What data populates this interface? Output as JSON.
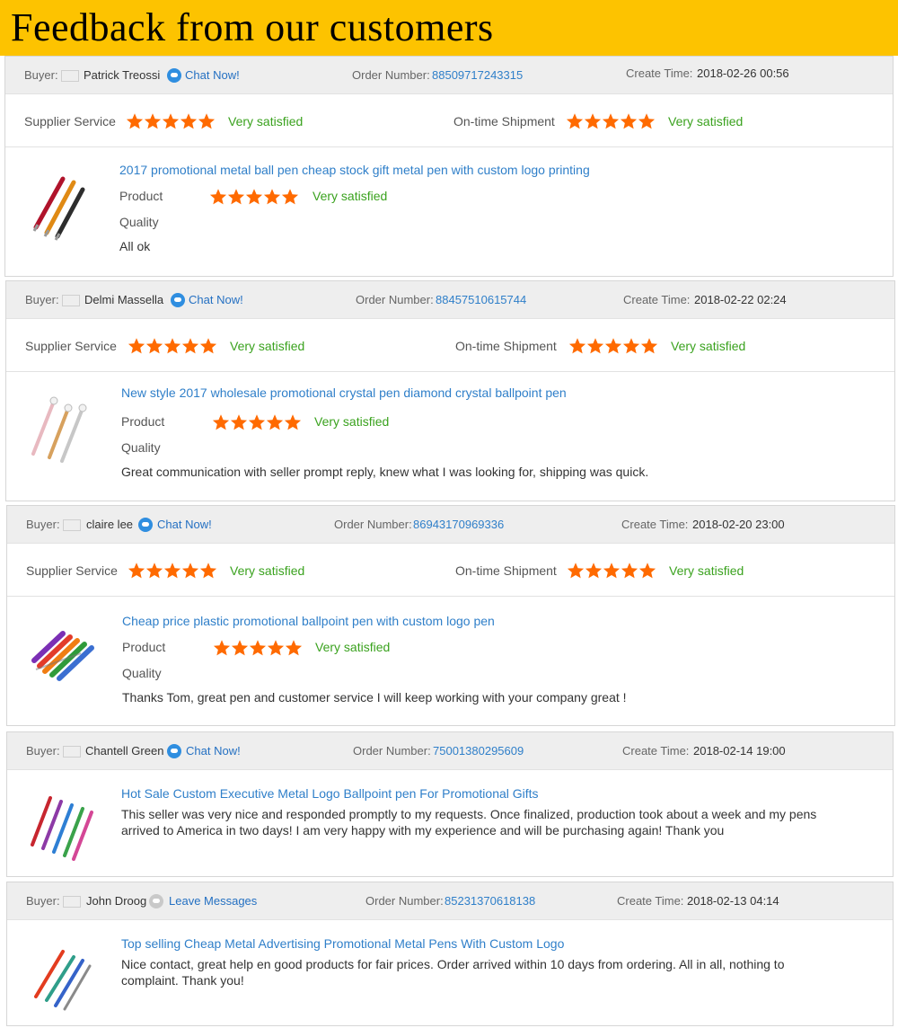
{
  "banner": {
    "title": "Feedback from our customers"
  },
  "labels": {
    "buyer": "Buyer:",
    "order_number": "Order Number:",
    "create_time": "Create Time:",
    "supplier_service": "Supplier Service",
    "ontime_shipment": "On-time Shipment",
    "product": "Product",
    "quality": "Quality"
  },
  "colors": {
    "banner": "#fdc300",
    "star": "#ff6a00",
    "satisfied": "#3aa21e",
    "link": "#2f7fc9"
  },
  "reviews": [
    {
      "buyer_name": "Patrick Treossi",
      "flag": "italy-flag",
      "contact_label": "Chat Now!",
      "order_number": "88509717243315",
      "create_time": "2018-02-26 00:56",
      "supplier_rating": 5,
      "supplier_text": "Very satisfied",
      "shipment_rating": 5,
      "shipment_text": "Very satisfied",
      "product_title": "2017 promotional metal ball pen cheap stock gift metal pen with custom logo printing",
      "product_rating": 5,
      "product_text": "Very satisfied",
      "comment": "All ok"
    },
    {
      "buyer_name": "Delmi Massella",
      "flag": "usa-flag",
      "contact_label": "Chat Now!",
      "order_number": "88457510615744",
      "create_time": "2018-02-22 02:24",
      "supplier_rating": 5,
      "supplier_text": "Very satisfied",
      "shipment_rating": 5,
      "shipment_text": "Very satisfied",
      "product_title": "New style 2017 wholesale promotional crystal pen diamond crystal ballpoint pen",
      "product_rating": 5,
      "product_text": "Very satisfied",
      "comment": "Great communication with seller prompt reply, knew what I was looking for, shipping was quick."
    },
    {
      "buyer_name": "claire lee",
      "flag": "australia-flag",
      "contact_label": "Chat Now!",
      "order_number": "86943170969336",
      "create_time": "2018-02-20 23:00",
      "supplier_rating": 5,
      "supplier_text": "Very satisfied",
      "shipment_rating": 5,
      "shipment_text": "Very satisfied",
      "product_title": "Cheap price plastic promotional ballpoint pen with custom logo pen",
      "product_rating": 5,
      "product_text": "Very satisfied",
      "comment": "Thanks Tom, great pen and customer service I will keep working with your company great !"
    },
    {
      "buyer_name": "Chantell Green",
      "flag": "usa-flag",
      "contact_label": "Chat Now!",
      "order_number": "75001380295609",
      "create_time": "2018-02-14 19:00",
      "product_title": "Hot Sale Custom Executive Metal Logo Ballpoint pen For Promotional Gifts",
      "comment_line1": "This seller was very nice and responded promptly to my requests. Once finalized, production took about a week and my pens",
      "comment_line2": "arrived to America in two days! I am very happy with my experience and will be purchasing again! Thank you"
    },
    {
      "buyer_name": "John Droog",
      "flag": "netherlands-flag",
      "contact_label": "Leave Messages",
      "order_number": "85231370618138",
      "create_time": "2018-02-13 04:14",
      "product_title": "Top selling Cheap Metal Advertising Promotional Metal Pens With Custom Logo",
      "comment_line1": "Nice contact, great help en good products for fair prices. Order arrived within 10 days from ordering. All in all, nothing to",
      "comment_line2": "complaint. Thank you!"
    }
  ]
}
